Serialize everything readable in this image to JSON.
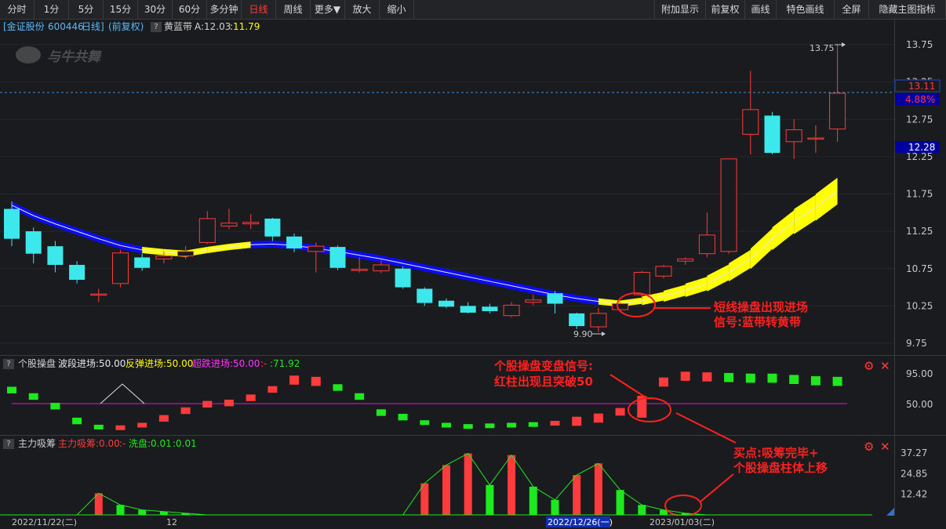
{
  "toolbar": {
    "left": [
      "分时",
      "1分",
      "5分",
      "15分",
      "30分",
      "60分",
      "多分钟",
      "日线",
      "周线",
      "更多▼",
      "放大",
      "缩小"
    ],
    "active": "日线",
    "right": [
      "附加显示",
      "前复权",
      "画线",
      "特色画线",
      "全屏",
      "隐藏主图指标"
    ]
  },
  "header": {
    "stock": "[金证股份",
    "code": "600446",
    "period": "日线]",
    "adj": "(前复权)",
    "indicator": "黄蓝带",
    "a_label": "A:12.03",
    "yellow_val": ":11.79",
    "help": "?"
  },
  "watermark": "与牛共舞",
  "main_axis": {
    "ticks": [
      "13.75",
      "13.25",
      "12.75",
      "12.25",
      "11.75",
      "11.25",
      "10.75",
      "10.25",
      "9.75"
    ],
    "ylim": [
      9.75,
      13.75
    ]
  },
  "price_tags": {
    "last": "13.11",
    "pct": "4.88%",
    "band": "12.28"
  },
  "labels": {
    "high": "13.75",
    "low": "9.90"
  },
  "annotations": {
    "a1": [
      "短线操盘出现进场",
      "信号:蓝带转黄带"
    ],
    "a2": [
      "个股操盘变盘信号:",
      "红柱出现且突破50"
    ],
    "a3": [
      "买点:吸筹完毕+",
      "个股操盘柱体上移"
    ]
  },
  "sub1": {
    "title": "个股操盘",
    "l1": "波段进场:50.00",
    "l2": "反弹进场:50.00",
    "l3": "超跌进场:50.00",
    "sep": ":-",
    "val": ":71.92",
    "ticks": [
      "95.00",
      "50.00"
    ]
  },
  "sub2": {
    "title": "主力吸筹",
    "l1": "主力吸筹:0.00",
    "sep": ":-",
    "l2": "洗盘:0.01",
    "l3": ":0.01",
    "ticks": [
      "37.27",
      "24.85",
      "12.42"
    ]
  },
  "dates": {
    "d1": "2022/11/22(二)",
    "d2": "12",
    "d3": "2022/12/26(一)",
    "d4": "2023/01/03(二)"
  },
  "colors": {
    "up": "#ff3b3b",
    "down": "#3ce8ec",
    "blue_band": "#0b0bf5",
    "yellow_band": "#ffff00",
    "green": "#1ee81e",
    "magenta": "#c010c0"
  },
  "chart_data": {
    "type": "candlestick",
    "ylim": [
      9.75,
      13.75
    ],
    "candles": [
      {
        "o": 11.55,
        "h": 11.65,
        "l": 11.05,
        "c": 11.15
      },
      {
        "o": 11.25,
        "h": 11.3,
        "l": 10.82,
        "c": 10.95
      },
      {
        "o": 11.05,
        "h": 11.12,
        "l": 10.7,
        "c": 10.8
      },
      {
        "o": 10.8,
        "h": 10.85,
        "l": 10.55,
        "c": 10.6
      },
      {
        "o": 10.4,
        "h": 10.48,
        "l": 10.3,
        "c": 10.41
      },
      {
        "o": 10.55,
        "h": 11.0,
        "l": 10.5,
        "c": 10.96
      },
      {
        "o": 10.9,
        "h": 10.95,
        "l": 10.72,
        "c": 10.76
      },
      {
        "o": 10.88,
        "h": 10.98,
        "l": 10.82,
        "c": 10.92
      },
      {
        "o": 10.92,
        "h": 11.05,
        "l": 10.88,
        "c": 10.98
      },
      {
        "o": 11.1,
        "h": 11.52,
        "l": 11.08,
        "c": 11.42
      },
      {
        "o": 11.32,
        "h": 11.55,
        "l": 11.28,
        "c": 11.36
      },
      {
        "o": 11.35,
        "h": 11.48,
        "l": 11.28,
        "c": 11.37
      },
      {
        "o": 11.42,
        "h": 11.43,
        "l": 11.12,
        "c": 11.18
      },
      {
        "o": 11.18,
        "h": 11.22,
        "l": 10.97,
        "c": 11.02
      },
      {
        "o": 10.98,
        "h": 11.1,
        "l": 10.7,
        "c": 11.05
      },
      {
        "o": 11.04,
        "h": 11.06,
        "l": 10.73,
        "c": 10.76
      },
      {
        "o": 10.73,
        "h": 10.9,
        "l": 10.7,
        "c": 10.74
      },
      {
        "o": 10.72,
        "h": 10.86,
        "l": 10.69,
        "c": 10.8
      },
      {
        "o": 10.75,
        "h": 10.78,
        "l": 10.48,
        "c": 10.5
      },
      {
        "o": 10.48,
        "h": 10.5,
        "l": 10.25,
        "c": 10.29
      },
      {
        "o": 10.32,
        "h": 10.35,
        "l": 10.22,
        "c": 10.24
      },
      {
        "o": 10.25,
        "h": 10.3,
        "l": 10.15,
        "c": 10.16
      },
      {
        "o": 10.24,
        "h": 10.28,
        "l": 10.15,
        "c": 10.18
      },
      {
        "o": 10.12,
        "h": 10.3,
        "l": 10.1,
        "c": 10.26
      },
      {
        "o": 10.3,
        "h": 10.4,
        "l": 10.26,
        "c": 10.33
      },
      {
        "o": 10.42,
        "h": 10.45,
        "l": 10.15,
        "c": 10.28
      },
      {
        "o": 10.15,
        "h": 10.16,
        "l": 9.94,
        "c": 9.98
      },
      {
        "o": 9.97,
        "h": 10.22,
        "l": 9.9,
        "c": 10.15
      },
      {
        "o": 10.2,
        "h": 10.3,
        "l": 10.18,
        "c": 10.28
      },
      {
        "o": 10.4,
        "h": 10.72,
        "l": 10.35,
        "c": 10.7
      },
      {
        "o": 10.65,
        "h": 10.8,
        "l": 10.62,
        "c": 10.78
      },
      {
        "o": 10.85,
        "h": 10.9,
        "l": 10.8,
        "c": 10.88
      },
      {
        "o": 10.95,
        "h": 11.5,
        "l": 10.9,
        "c": 11.2
      },
      {
        "o": 10.98,
        "h": 12.22,
        "l": 10.95,
        "c": 12.22
      },
      {
        "o": 12.55,
        "h": 13.4,
        "l": 12.28,
        "c": 12.88
      },
      {
        "o": 12.8,
        "h": 12.85,
        "l": 12.28,
        "c": 12.3
      },
      {
        "o": 12.45,
        "h": 12.75,
        "l": 12.22,
        "c": 12.61
      },
      {
        "o": 12.5,
        "h": 12.67,
        "l": 12.3,
        "c": 12.5
      },
      {
        "o": 12.62,
        "h": 13.75,
        "l": 12.45,
        "c": 13.1
      }
    ],
    "band": [
      11.6,
      11.46,
      11.35,
      11.25,
      11.15,
      11.06,
      11.0,
      10.97,
      10.95,
      11.0,
      11.04,
      11.07,
      11.08,
      11.06,
      11.02,
      10.98,
      10.93,
      10.88,
      10.82,
      10.76,
      10.7,
      10.64,
      10.58,
      10.52,
      10.46,
      10.4,
      10.35,
      10.31,
      10.28,
      10.32,
      10.38,
      10.46,
      10.55,
      10.7,
      10.88,
      11.15,
      11.38,
      11.57,
      11.79
    ],
    "band_color": [
      "b",
      "b",
      "b",
      "b",
      "b",
      "b",
      "b",
      "y",
      "y",
      "y",
      "y",
      "y",
      "b",
      "b",
      "b",
      "b",
      "b",
      "b",
      "b",
      "b",
      "b",
      "b",
      "b",
      "b",
      "b",
      "b",
      "b",
      "b",
      "y",
      "y",
      "y",
      "y",
      "y",
      "y",
      "y",
      "y",
      "y",
      "y",
      "y"
    ],
    "sub1_ylim": [
      0,
      100
    ],
    "sub1_values": [
      70,
      60,
      45,
      22,
      11,
      10,
      14,
      26,
      38,
      48,
      50,
      58,
      71,
      85,
      83,
      74,
      60,
      35,
      28,
      18,
      14,
      12,
      13,
      14,
      15,
      17,
      21,
      26,
      36,
      60,
      82,
      91,
      90,
      89,
      88,
      88,
      86,
      84,
      83
    ],
    "sub1_colors": [
      "g",
      "g",
      "g",
      "g",
      "g",
      "r",
      "r",
      "r",
      "r",
      "r",
      "r",
      "r",
      "r",
      "r",
      "r",
      "g",
      "g",
      "g",
      "g",
      "g",
      "g",
      "g",
      "g",
      "g",
      "g",
      "r",
      "r",
      "r",
      "r",
      "r",
      "r",
      "r",
      "r",
      "g",
      "g",
      "g",
      "g",
      "g",
      "g"
    ],
    "sub2_ylim": [
      0,
      40
    ],
    "sub2_values": [
      0,
      0,
      0,
      0,
      13,
      6,
      3,
      2,
      1,
      0,
      0,
      0,
      0,
      0,
      0,
      0,
      0,
      0,
      0,
      19,
      30,
      37,
      18,
      36,
      17,
      9,
      24,
      31,
      15,
      6,
      3,
      1,
      0,
      0,
      0,
      0,
      0,
      0,
      0
    ],
    "sub2_colors": [
      "g",
      "g",
      "g",
      "g",
      "r",
      "g",
      "g",
      "g",
      "g",
      "g",
      "g",
      "g",
      "g",
      "g",
      "g",
      "g",
      "g",
      "g",
      "g",
      "r",
      "r",
      "r",
      "g",
      "r",
      "g",
      "g",
      "r",
      "r",
      "g",
      "g",
      "g",
      "g",
      "g",
      "g",
      "g",
      "g",
      "g",
      "g",
      "g"
    ]
  }
}
